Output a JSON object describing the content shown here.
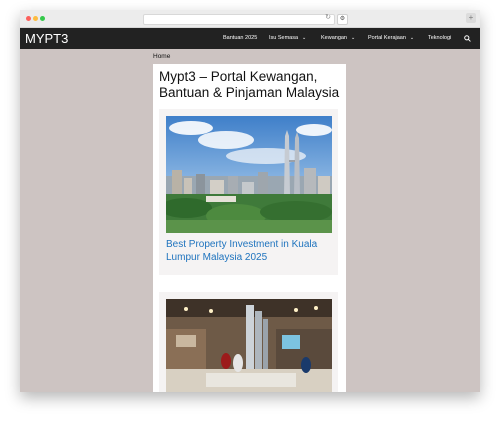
{
  "site": {
    "title": "MYPT3",
    "breadcrumb": "Home",
    "page_title": "Mypt3 – Portal Kewangan, Bantuan & Pinjaman Malaysia"
  },
  "nav": {
    "items": [
      {
        "label": "Bantuan 2025",
        "has_dropdown": false
      },
      {
        "label": "Isu Semasa",
        "has_dropdown": true
      },
      {
        "label": "Kewangan",
        "has_dropdown": true
      },
      {
        "label": "Portal Kerajaan",
        "has_dropdown": true
      },
      {
        "label": "Teknologi",
        "has_dropdown": false
      }
    ],
    "chevron": "⌄",
    "search_icon": "search-icon"
  },
  "posts": [
    {
      "title": "Best Property Investment in Kuala Lumpur Malaysia 2025",
      "image": "kuala-lumpur-skyline-photo"
    },
    {
      "title": "",
      "image": "property-showroom-model-photo"
    }
  ],
  "colors": {
    "navbar": "#222222",
    "page_background": "#cdc4c2",
    "link": "#1e73be"
  }
}
